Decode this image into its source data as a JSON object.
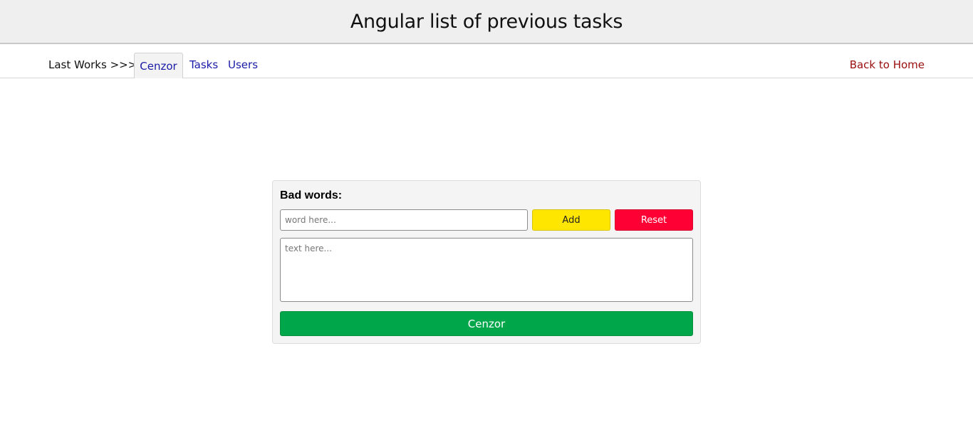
{
  "header": {
    "title": "Angular list of previous tasks"
  },
  "nav": {
    "prefix": "Last Works >>>",
    "tabs": [
      {
        "label": "Cenzor",
        "active": true
      },
      {
        "label": "Tasks",
        "active": false
      },
      {
        "label": "Users",
        "active": false
      }
    ],
    "home_link": "Back to Home"
  },
  "panel": {
    "title": "Bad words:",
    "word_input": {
      "value": "",
      "placeholder": "word here..."
    },
    "add_label": "Add",
    "reset_label": "Reset",
    "text_area": {
      "value": "",
      "placeholder": "text here..."
    },
    "cenzor_label": "Cenzor"
  },
  "colors": {
    "add": "#ffe600",
    "reset": "#ff0035",
    "cenzor": "#00a74a",
    "tab_link": "#1a1aa8",
    "home_link": "#9a0d0d"
  }
}
